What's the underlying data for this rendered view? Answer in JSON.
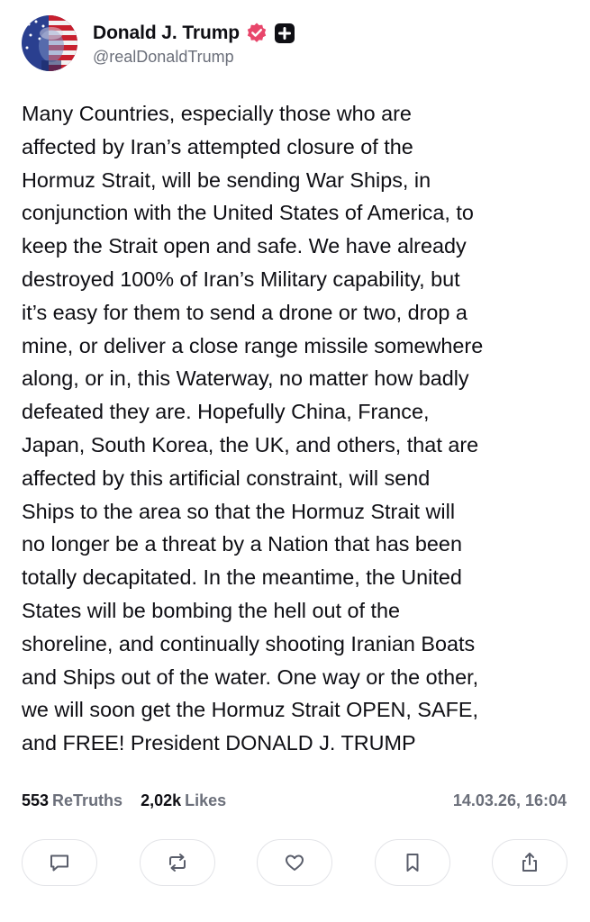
{
  "author": {
    "display_name": "Donald J. Trump",
    "handle": "@realDonaldTrump",
    "verified_badge_color": "#e8466b"
  },
  "post": {
    "text": "Many Countries, especially those who are\naffected by Iran’s attempted closure of the\nHormuz Strait, will be sending War Ships, in\nconjunction with the United States of America, to\nkeep the Strait open and safe. We have already\ndestroyed 100% of Iran’s Military capability, but\nit’s easy for them to send a drone or two, drop a\nmine, or deliver a close range missile somewhere\nalong, or in, this Waterway, no matter how badly\ndefeated they are. Hopefully China, France,\nJapan, South Korea, the UK, and others, that are\naffected by this artificial constraint, will send\nShips to the area so that the Hormuz Strait will\nno longer be a threat by a Nation that has been\ntotally decapitated. In the meantime, the United\nStates will be bombing the hell out of the\nshoreline, and continually shooting Iranian Boats\nand Ships out of the water. One way or the other,\nwe will soon get the Hormuz Strait OPEN, SAFE,\nand FREE! President DONALD J. TRUMP"
  },
  "stats": {
    "retruths_count": "553",
    "retruths_label": "ReTruths",
    "likes_count": "2,02k",
    "likes_label": "Likes",
    "timestamp": "14.03.26, 16:04"
  },
  "actions": [
    {
      "name": "reply",
      "icon": "comment-icon"
    },
    {
      "name": "retruth",
      "icon": "retruth-icon"
    },
    {
      "name": "like",
      "icon": "heart-icon"
    },
    {
      "name": "bookmark",
      "icon": "bookmark-icon"
    },
    {
      "name": "share",
      "icon": "share-icon"
    }
  ]
}
